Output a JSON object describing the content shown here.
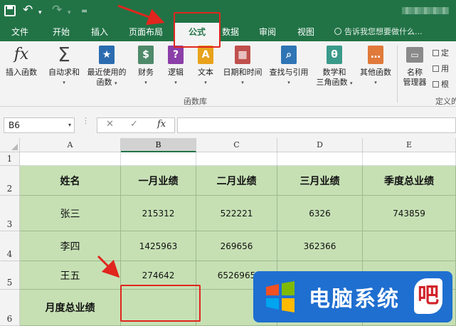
{
  "quick_access": {
    "save_icon": "save-icon",
    "undo_icon": "undo-icon",
    "redo_icon": "redo-icon",
    "undo_glyph": "↶",
    "redo_glyph": "↷",
    "dropdown_glyph": "▾",
    "customize_glyph": "="
  },
  "tabs": [
    {
      "label": "文件"
    },
    {
      "label": "开始"
    },
    {
      "label": "插入"
    },
    {
      "label": "页面布局"
    },
    {
      "label": "公式",
      "active": true
    },
    {
      "label": "数据"
    },
    {
      "label": "审阅"
    },
    {
      "label": "视图"
    }
  ],
  "tell_me": "告诉我您想要做什么...",
  "ribbon": {
    "buttons": [
      {
        "label": "插入函数",
        "icon": "fx-icon",
        "glyph": "fx"
      },
      {
        "label": "自动求和",
        "icon": "sigma-icon",
        "glyph": "Σ",
        "dropdown": "▾"
      },
      {
        "label": "最近使用的",
        "label2": "函数",
        "icon": "star-book-icon",
        "glyph": "★",
        "dropdown": "▾"
      },
      {
        "label": "财务",
        "icon": "finance-book-icon",
        "glyph": "$",
        "dropdown": "▾"
      },
      {
        "label": "逻辑",
        "icon": "logic-book-icon",
        "glyph": "?",
        "dropdown": "▾"
      },
      {
        "label": "文本",
        "icon": "text-book-icon",
        "glyph": "A",
        "dropdown": "▾"
      },
      {
        "label": "日期和时间",
        "icon": "calendar-book-icon",
        "glyph": "▦",
        "dropdown": "▾"
      },
      {
        "label": "查找与引用",
        "icon": "lookup-book-icon",
        "glyph": "⌕",
        "dropdown": "▾"
      },
      {
        "label": "数学和",
        "label2": "三角函数",
        "icon": "math-book-icon",
        "glyph": "θ",
        "dropdown": "▾"
      },
      {
        "label": "其他函数",
        "icon": "more-functions-book-icon",
        "glyph": "…",
        "dropdown": "▾"
      },
      {
        "label": "名称",
        "label2": "管理器",
        "icon": "name-manager-icon",
        "glyph": "▭"
      }
    ],
    "group_label": "函数库",
    "defined_names_label": "定义的",
    "side_items": [
      "定",
      "用",
      "根"
    ]
  },
  "formula_bar": {
    "name_box": "B6",
    "name_arrow": "▾",
    "cancel_glyph": "✕",
    "enter_glyph": "✓",
    "fx_glyph": "fx",
    "content": ""
  },
  "grid": {
    "columns": [
      "A",
      "B",
      "C",
      "D",
      "E"
    ],
    "rows": [
      "1",
      "2",
      "3",
      "4",
      "5",
      "6"
    ],
    "selected_column": "B",
    "selected_cell": "B6",
    "header_row": [
      "姓名",
      "一月业绩",
      "二月业绩",
      "三月业绩",
      "季度总业绩"
    ],
    "data_rows": [
      [
        "张三",
        "215312",
        "522221",
        "6326",
        "743859"
      ],
      [
        "李四",
        "1425963",
        "269656",
        "362366",
        ""
      ],
      [
        "王五",
        "274642",
        "6526965",
        "",
        ""
      ]
    ],
    "total_row_label": "月度总业绩"
  },
  "watermark": {
    "text": "电脑系统",
    "last_char": "吧"
  },
  "colors": {
    "excel_green": "#217346",
    "table_fill": "#c6e0b4",
    "annotation_red": "#e0261e",
    "watermark_blue": "#1f6fd0"
  }
}
